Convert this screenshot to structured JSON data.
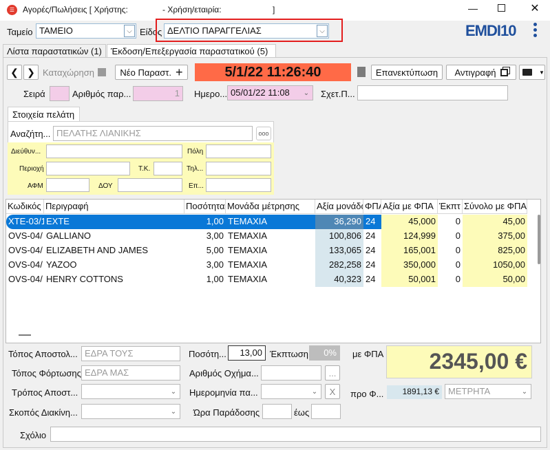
{
  "window": {
    "title": "Αγορές/Πωλήσεις  [ Χρήστης: ",
    "title_mid": " - Χρήση/εταιρία: ",
    "title_end": "]"
  },
  "header": {
    "tameio_label": "Ταμείο",
    "tameio_value": "ΤΑΜΕΙΟ",
    "eidos_label": "Είδος",
    "eidos_value": "ΔΕΛΤΙΟ ΠΑΡΑΓΓΕΛΙΑΣ",
    "logo_text": "EMDI10"
  },
  "tabs": [
    {
      "label": "Λίστα παραστατικών (1)"
    },
    {
      "label": "Έκδοση/Επεξεργασία παραστατικού (5)"
    }
  ],
  "toolbar": {
    "save_label": "Καταχώρηση",
    "new_label": "Νέο Παραστ.",
    "datetime": "5/1/22 11:26:40",
    "reprint_label": "Επανεκτύπωση",
    "copy_label": "Αντιγραφή",
    "datetime_bg": "#ff6a47"
  },
  "docinfo": {
    "seira_label": "Σειρά",
    "arithmos_label": "Αριθμός παρ...",
    "arithmos_value": "1",
    "date_label": "Ημερο...",
    "date_value": "05/01/22 11:08",
    "sxet_label": "Σχετ.Π..."
  },
  "customer": {
    "tab_label": "Στοιχεία πελάτη",
    "search_label": "Αναζήτη...",
    "search_value": "ΠΕΛΑΤΗΣ ΛΙΑΝΙΚΗΣ",
    "more_label": "ooo",
    "address_label": "Διεύθυν...",
    "city_label": "Πόλη",
    "region_label": "Περιοχή",
    "tk_label": "Τ.Κ.",
    "phone_label": "Τηλ...",
    "afm_label": "ΑΦΜ",
    "doy_label": "ΔΟΥ",
    "ep_label": "Επ..."
  },
  "grid": {
    "headers": [
      "Κωδικός",
      "Περιγραφή",
      "Ποσότητα",
      "Μονάδα μέτρησης",
      "Αξία μονάδας",
      "ΦΠΑ",
      "Αξία με ΦΠΑ",
      "Έκπτ",
      "Σύνολο με ΦΠΑ"
    ],
    "rows": [
      {
        "code": "XTE-03/1",
        "desc": "EXTE",
        "qty": "1,00",
        "unit": "ΤΕΜΑΧΙΑ",
        "price": "36,290",
        "vat": "24",
        "pricevat": "45,000",
        "disc": "0",
        "total": "45,00"
      },
      {
        "code": "OVS-04/",
        "desc": "GALLIANO",
        "qty": "3,00",
        "unit": "ΤΕΜΑΧΙΑ",
        "price": "100,806",
        "vat": "24",
        "pricevat": "124,999",
        "disc": "0",
        "total": "375,00"
      },
      {
        "code": "OVS-04/",
        "desc": "ELIZABETH AND JAMES",
        "qty": "5,00",
        "unit": "ΤΕΜΑΧΙΑ",
        "price": "133,065",
        "vat": "24",
        "pricevat": "165,001",
        "disc": "0",
        "total": "825,00"
      },
      {
        "code": "OVS-04/",
        "desc": "YAZOO",
        "qty": "3,00",
        "unit": "ΤΕΜΑΧΙΑ",
        "price": "282,258",
        "vat": "24",
        "pricevat": "350,000",
        "disc": "0",
        "total": "1050,00"
      },
      {
        "code": "OVS-04/",
        "desc": "HENRY COTTONS",
        "qty": "1,00",
        "unit": "ΤΕΜΑΧΙΑ",
        "price": "40,323",
        "vat": "24",
        "pricevat": "50,001",
        "disc": "0",
        "total": "50,00"
      }
    ]
  },
  "footer": {
    "topos_apost_label": "Τόπος Αποστολ...",
    "topos_apost_value": "ΕΔΡΑ ΤΟΥΣ",
    "topos_fort_label": "Τόπος Φόρτωσης",
    "topos_fort_value": "ΕΔΡΑ ΜΑΣ",
    "tropos_label": "Τρόπος Αποστ...",
    "skopos_label": "Σκοπός Διακίνη...",
    "posotita_label": "Ποσότη...",
    "posotita_value": "13,00",
    "ekptosi_label": "Έκπτωση",
    "ekptosi_value": "0%",
    "oxima_label": "Αριθμός Οχήμα...",
    "imerominia_label": "Ημερομηνία πα...",
    "ora_label": "Ώρα Παράδοσης",
    "eos_label": "έως",
    "me_fpa_label": "με ΦΠΑ",
    "total": "2345,00 €",
    "pro_fpa_label": "προ Φ...",
    "pro_fpa_value": "1891,13 €",
    "payment_value": "ΜΕΤΡΗΤΑ",
    "comment_label": "Σχόλιο",
    "x_label": "X",
    "dots_label": "..."
  }
}
